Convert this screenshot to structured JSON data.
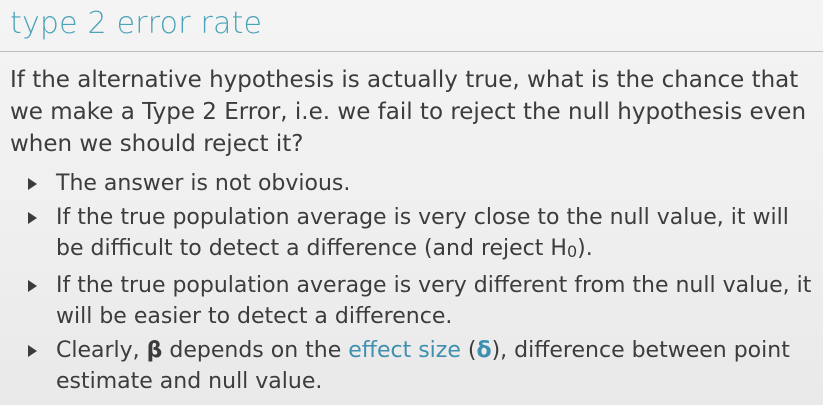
{
  "title": "type 2 error rate",
  "intro": "If the alternative hypothesis is actually true, what is the chance that we make a Type 2 Error, i.e. we fail to reject the null hypothesis even when we should reject it?",
  "bullets": [
    {
      "text": "The answer is not obvious."
    },
    {
      "text_before": "If the true population average is very close to the null value, it will be difficult to detect a difference (and reject H",
      "subscript": "0",
      "text_after": ")."
    },
    {
      "text": "If the true population average is very different from the null value, it will be easier to detect a difference."
    },
    {
      "prefix": "Clearly, ",
      "symbol": "β",
      "middle": " depends on the ",
      "accent_text": "effect size",
      "paren_open": " (",
      "delta": "δ",
      "paren_close": ")",
      "suffix": ", difference between point estimate and null value."
    }
  ],
  "colors": {
    "title": "#4aa3b8",
    "accent": "#3f8fb1",
    "text": "#3c3c3c",
    "background": "#efefef"
  },
  "icons": {
    "bullet": "triangle-right-icon"
  }
}
